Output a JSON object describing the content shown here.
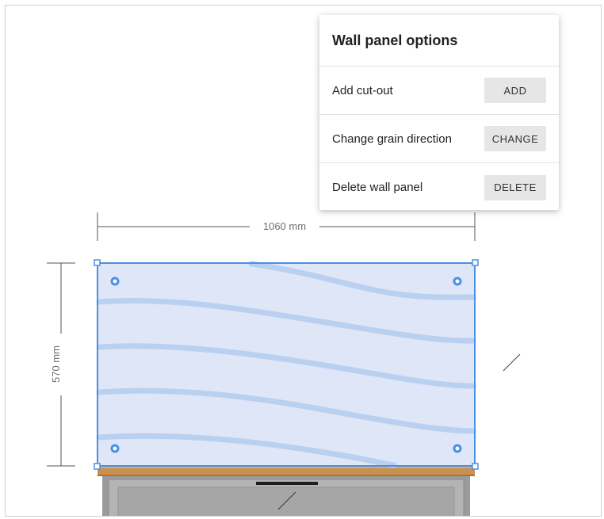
{
  "dimensions": {
    "width_label": "1060 mm",
    "height_label": "570 mm"
  },
  "popup": {
    "title": "Wall panel options",
    "rows": [
      {
        "label": "Add cut-out",
        "button": "ADD"
      },
      {
        "label": "Change grain direction",
        "button": "CHANGE"
      },
      {
        "label": "Delete wall panel",
        "button": "DELETE"
      }
    ]
  },
  "colors": {
    "selection": "#4a8fe7",
    "panel_fill": "#dfe6f7",
    "grain": "#b9d0f0",
    "worktop": "#c9914f",
    "cabinet": "#9b9b9b"
  }
}
